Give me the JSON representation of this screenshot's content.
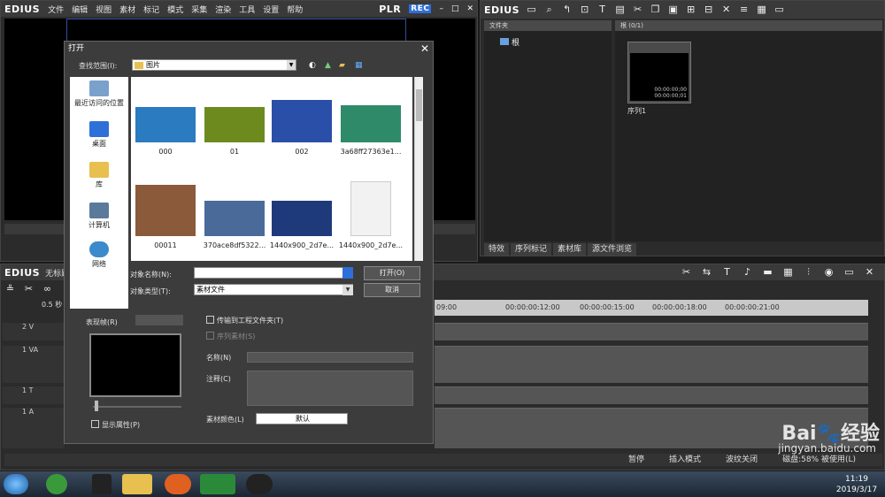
{
  "player": {
    "logo": "EDIUS",
    "menu": [
      "文件",
      "编辑",
      "视图",
      "素材",
      "标记",
      "模式",
      "采集",
      "渲染",
      "工具",
      "设置",
      "帮助"
    ],
    "plr": "PLR",
    "rec": "REC"
  },
  "bin": {
    "logo": "EDIUS",
    "tree_header": "文件夹",
    "tree_root": "根",
    "clips_header": "根 (0/1)",
    "clip_label": "序列1",
    "clip_tc1": "00:00:00;00",
    "clip_tc2": "00:00:00;01",
    "tabs": [
      "特效",
      "序列标记",
      "素材库",
      "源文件浏览"
    ]
  },
  "timeline": {
    "logo": "EDIUS",
    "title": "无标题",
    "zoom": "0.5 秒",
    "ruler_ticks": [
      "09:00",
      "00:00:00:12:00",
      "00:00:00:15:00",
      "00:00:00:18:00",
      "00:00:00:21:00"
    ],
    "tracks": [
      "2 V",
      "1 VA",
      "1 T",
      "1 A"
    ],
    "status": [
      "暂停",
      "插入模式",
      "波纹关闭",
      "磁盘:58% 被使用(L)"
    ]
  },
  "dialog": {
    "title": "打开",
    "lookin_label": "查找范围(I):",
    "lookin_value": "图片",
    "places": [
      "最近访问的位置",
      "桌面",
      "库",
      "计算机",
      "网络"
    ],
    "files": [
      {
        "name": "000",
        "color": "#2a7bbf"
      },
      {
        "name": "01",
        "color": "#6d8a1e"
      },
      {
        "name": "002",
        "color": "#2a4fa8"
      },
      {
        "name": "3a68ff27363e1...",
        "color": "#2f8a6a"
      },
      {
        "name": "00011",
        "color": "#8a5a3a"
      },
      {
        "name": "370ace8df5322...",
        "color": "#4a6a9a"
      },
      {
        "name": "1440x900_2d7e...",
        "color": "#1e3a7a"
      },
      {
        "name": "1440x900_2d7e...",
        "color": "#f2f2f2"
      }
    ],
    "filename_label": "对象名称(N):",
    "filename_value": "",
    "filetype_label": "对象类型(T):",
    "filetype_value": "素材文件",
    "open_button": "打开(O)",
    "cancel_button": "取消",
    "preview_label": "表现帧(R)",
    "show_props": "显示属性(P)",
    "transfer": "传输到工程文件夹(T)",
    "seq_clip": "序列素材(S)",
    "name_label": "名称(N)",
    "comment_label": "注释(C)",
    "clip_color_label": "素材颜色(L)",
    "clip_color_value": "默认"
  },
  "taskbar": {
    "time": "11:19",
    "date": "2019/3/17"
  },
  "watermark": {
    "brand": "Bai",
    "brand2": "经验",
    "url": "jingyan.baidu.com"
  }
}
